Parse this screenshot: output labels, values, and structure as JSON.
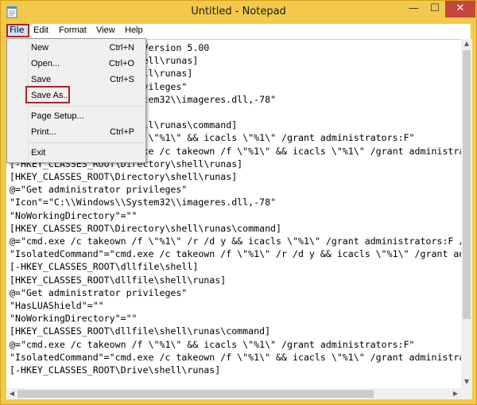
{
  "window": {
    "title": "Untitled - Notepad"
  },
  "controls": {
    "minimize": "—",
    "maximize": "☐",
    "close": "✕"
  },
  "menubar": {
    "file": "File",
    "edit": "Edit",
    "format": "Format",
    "view": "View",
    "help": "Help"
  },
  "file_menu": {
    "new_label": "New",
    "new_shortcut": "Ctrl+N",
    "open_label": "Open...",
    "open_shortcut": "Ctrl+O",
    "save_label": "Save",
    "save_shortcut": "Ctrl+S",
    "saveas_label": "Save As...",
    "pagesetup_label": "Page Setup...",
    "print_label": "Print...",
    "print_shortcut": "Ctrl+P",
    "exit_label": "Exit"
  },
  "editor": {
    "text": "Windows Registry Editor Version 5.00\n[-HKEY_CLASSES_ROOT\\*\\shell\\runas]\n[HKEY_CLASSES_ROOT\\*\\shell\\runas]\n@=\"Get administrator privileges\"\n\"Icon\"=\"C:\\\\Windows\\\\System32\\\\imageres.dll,-78\"\n\"NoWorkingDirectory\"=\"\"\n[HKEY_CLASSES_ROOT\\*\\shell\\runas\\command]\n@=\"cmd.exe /c takeown /f \\\"%1\\\" && icacls \\\"%1\\\" /grant administrators:F\"\n\"IsolatedCommand\"=\"cmd.exe /c takeown /f \\\"%1\\\" && icacls \\\"%1\\\" /grant administrators:F\"\n[-HKEY_CLASSES_ROOT\\Directory\\shell\\runas]\n[HKEY_CLASSES_ROOT\\Directory\\shell\\runas]\n@=\"Get administrator privileges\"\n\"Icon\"=\"C:\\\\Windows\\\\System32\\\\imageres.dll,-78\"\n\"NoWorkingDirectory\"=\"\"\n[HKEY_CLASSES_ROOT\\Directory\\shell\\runas\\command]\n@=\"cmd.exe /c takeown /f \\\"%1\\\" /r /d y && icacls \\\"%1\\\" /grant administrators:F /t\"\n\"IsolatedCommand\"=\"cmd.exe /c takeown /f \\\"%1\\\" /r /d y && icacls \\\"%1\\\" /grant administrators:F /t\"\n[-HKEY_CLASSES_ROOT\\dllfile\\shell]\n[HKEY_CLASSES_ROOT\\dllfile\\shell\\runas]\n@=\"Get administrator privileges\"\n\"HasLUAShield\"=\"\"\n\"NoWorkingDirectory\"=\"\"\n[HKEY_CLASSES_ROOT\\dllfile\\shell\\runas\\command]\n@=\"cmd.exe /c takeown /f \\\"%1\\\" && icacls \\\"%1\\\" /grant administrators:F\"\n\"IsolatedCommand\"=\"cmd.exe /c takeown /f \\\"%1\\\" && icacls \\\"%1\\\" /grant administrators:F\"\n[-HKEY_CLASSES_ROOT\\Drive\\shell\\runas]"
  },
  "colors": {
    "frame": "#f2c94c",
    "close_button": "#c7463b",
    "highlight_border": "#b22222",
    "menu_selected": "#cce4f7"
  }
}
